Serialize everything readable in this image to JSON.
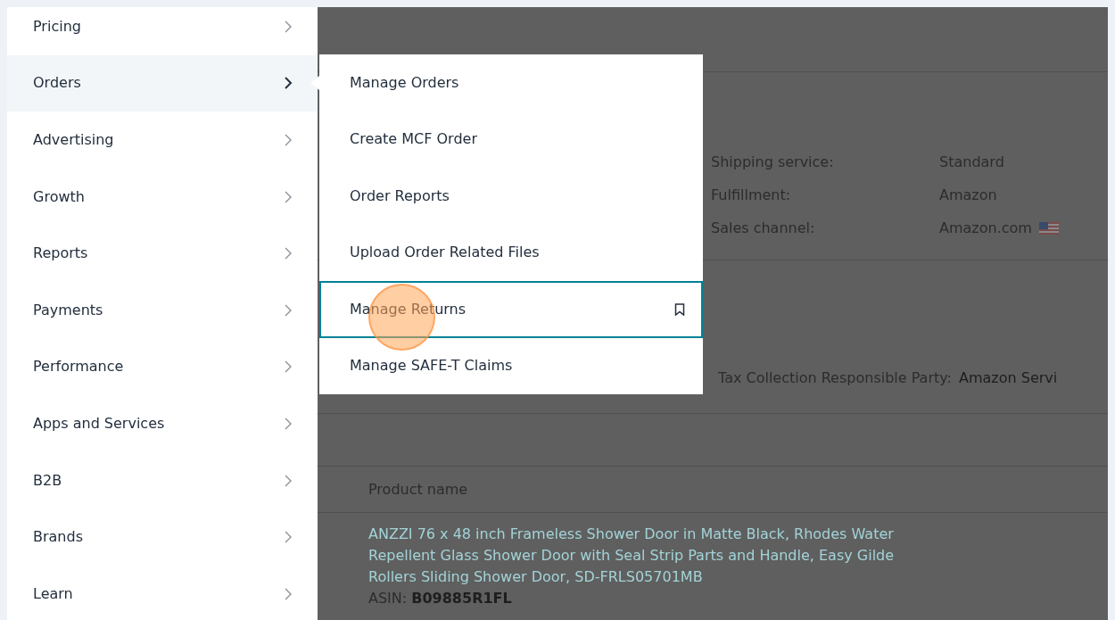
{
  "sidebar": {
    "items": [
      {
        "label": "Pricing",
        "selected": false
      },
      {
        "label": "Orders",
        "selected": true
      },
      {
        "label": "Advertising",
        "selected": false
      },
      {
        "label": "Growth",
        "selected": false
      },
      {
        "label": "Reports",
        "selected": false
      },
      {
        "label": "Payments",
        "selected": false
      },
      {
        "label": "Performance",
        "selected": false
      },
      {
        "label": "Apps and Services",
        "selected": false
      },
      {
        "label": "B2B",
        "selected": false
      },
      {
        "label": "Brands",
        "selected": false
      },
      {
        "label": "Learn",
        "selected": false
      }
    ]
  },
  "submenu": {
    "items": [
      {
        "label": "Manage Orders",
        "selected": false
      },
      {
        "label": "Create MCF Order",
        "selected": false
      },
      {
        "label": "Order Reports",
        "selected": false
      },
      {
        "label": "Upload Order Related Files",
        "selected": false
      },
      {
        "label": "Manage Returns",
        "selected": true
      },
      {
        "label": "Manage SAFE-T Claims",
        "selected": false
      }
    ]
  },
  "page": {
    "details": [
      {
        "label": "Shipping service:",
        "value": "Standard",
        "has_flag": false
      },
      {
        "label": "Fulfillment:",
        "value": "Amazon",
        "has_flag": false
      },
      {
        "label": "Sales channel:",
        "value": "Amazon.com",
        "has_flag": true
      }
    ],
    "tax": {
      "label": "Tax Collection Responsible Party:",
      "value": "Amazon Servi"
    },
    "table": {
      "columns": [
        "Product name"
      ],
      "rows": [
        {
          "product_name": "ANZZI 76 x 48 inch Frameless Shower Door in Matte Black, Rhodes Water Repellent Glass Shower Door with Seal Strip Parts and Handle, Easy Gilde Rollers Sliding Shower Door, SD-FRLS05701MB",
          "asin_label": "ASIN:",
          "asin": "B09885R1FL"
        }
      ]
    }
  }
}
